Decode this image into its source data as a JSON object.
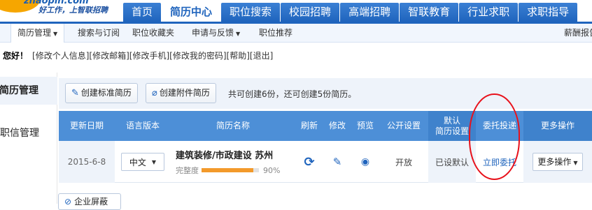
{
  "brand": {
    "logo_text": "zhaopin.com",
    "slogan": "好工作，上智联招聘"
  },
  "nav": {
    "tabs": [
      "首页",
      "简历中心",
      "职位搜索",
      "校园招聘",
      "高端招聘",
      "智联教育",
      "行业求职",
      "求职指导"
    ],
    "active_index": 1
  },
  "subnav": {
    "items": [
      "简历管理",
      "搜索与订阅",
      "职位收藏夹",
      "申请与反馈",
      "职位推荐"
    ],
    "right": "薪酬报告"
  },
  "hello": {
    "greeting": "您好！",
    "links": [
      "[修改个人信息]",
      "[修改邮箱]",
      "[修改手机]",
      "[修改我的密码]",
      "[帮助]",
      "[退出]"
    ]
  },
  "sidebar": {
    "items": [
      "简历管理",
      "职信管理"
    ]
  },
  "actions": {
    "create_standard": "创建标准简历",
    "create_attachment": "创建附件简历",
    "note": "共可创建6份，还可创建5份简历。"
  },
  "table": {
    "headers": [
      "更新日期",
      "语言版本",
      "简历名称",
      "刷新",
      "修改",
      "预览",
      "公开设置",
      "默认\n简历设置",
      "委托投递",
      "更多操作"
    ],
    "row": {
      "date": "2015-6-8",
      "language": "中文",
      "resume_name": "建筑装修/市政建设 苏州",
      "completeness_label": "完整度",
      "completeness_pct": "90%",
      "completeness_value": 0.9,
      "visibility": "开放",
      "default_setting": "已设默认",
      "entrust": "立即委托",
      "more": "更多操作"
    }
  },
  "bottom": {
    "label": "企业屏蔽"
  },
  "colors": {
    "nav_blue": "#1f64bd",
    "header_blue": "#4d8fd7",
    "annotation_red": "#e8111b",
    "progress_orange": "#f39a2b"
  }
}
